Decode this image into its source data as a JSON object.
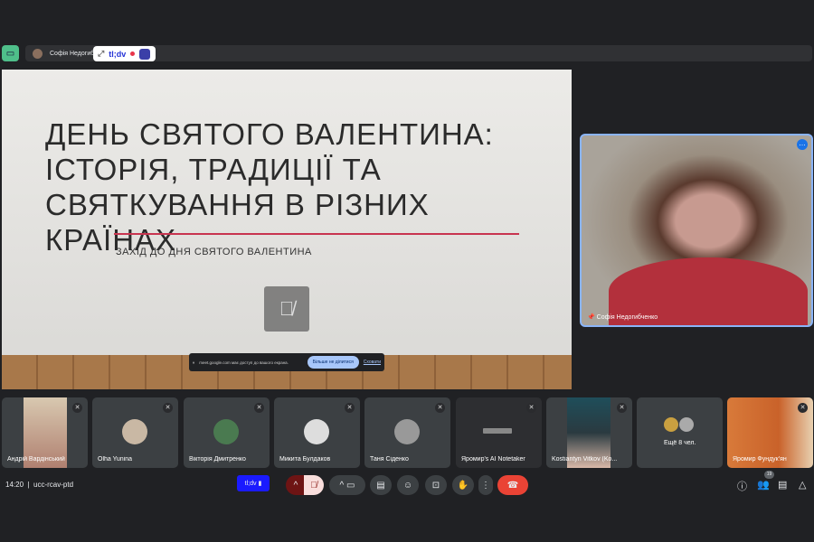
{
  "topbar": {
    "presenter_name": "Софія Недогибченко",
    "tldv_label": "tl;dv"
  },
  "slide": {
    "title": "ДЕНЬ СВЯТОГО ВАЛЕНТИНА: ІСТОРІЯ, ТРАДИЦІЇ ТА СВЯТКУВАННЯ В РІЗНИХ КРАЇНАХ",
    "subtitle": "ЗАХІД ДО ДНЯ СВЯТОГО ВАЛЕНТИНА"
  },
  "share_bar": {
    "message": "meet.google.com має доступ до вашого екрана.",
    "stop_label": "Більше не ділитися",
    "hide_label": "Сховати"
  },
  "self_view": {
    "name": "Софія Недогибченко"
  },
  "participants": [
    "Андрій Вардінський",
    "Olha Yunina",
    "Вікторія Дмитренко",
    "Микита Булдаков",
    "Таня Сіденко",
    "Яромир's AI Notetaker",
    "Kostiantyn Vitkov (Ko...",
    "Ещё 8 чел.",
    "Яромир Фундук'ян"
  ],
  "bottom": {
    "time": "14:20",
    "meeting_code": "ucc-rcav-ptd",
    "tldv_label": "tl;dv",
    "people_count": "19"
  },
  "colors": {
    "accent": "#8ab4f8",
    "end_call": "#ea4335",
    "mic_off_bg": "#f9dedc",
    "tldv_blue": "#1a1aff"
  }
}
